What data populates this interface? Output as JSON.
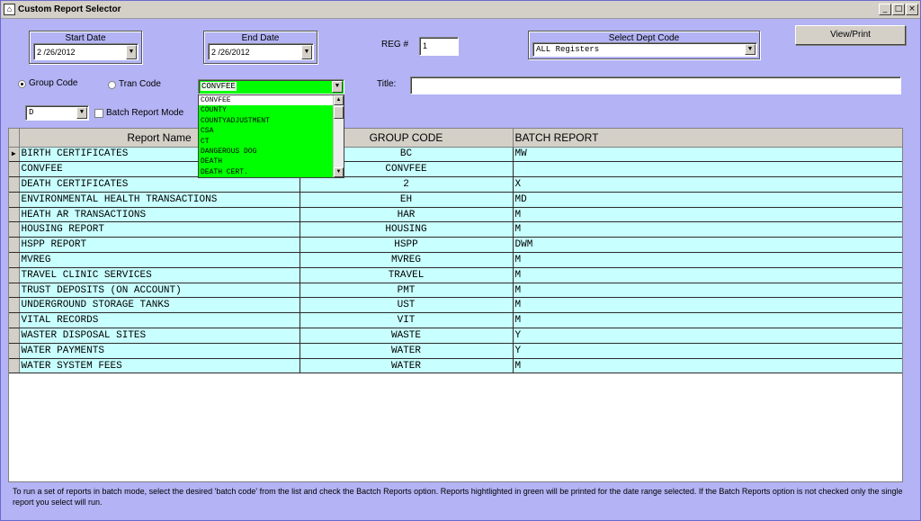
{
  "window": {
    "app_icon": "report-icon",
    "title": "Custom Report Selector",
    "min_glyph": "_",
    "max_glyph": "□",
    "close_glyph": "×"
  },
  "dates": {
    "start_label": "Start Date",
    "start_value": "2 /26/2012",
    "end_label": "End Date",
    "end_value": "2 /26/2012"
  },
  "reg": {
    "label": "REG #",
    "value": "1"
  },
  "dept": {
    "label": "Select Dept Code",
    "value": "ALL Registers"
  },
  "view_print_label": "View/Print",
  "mode": {
    "group_code_label": "Group Code",
    "tran_code_label": "Tran Code",
    "group_code_checked": true,
    "tran_code_checked": false
  },
  "group_combo": {
    "value": "CONVFEE",
    "highlight_color": "#00ff00",
    "options": [
      "CONVFEE",
      "COUNTY",
      "COUNTYADJUSTMENT",
      "CSA",
      "CT",
      "DANGEROUS DOG",
      "DEATH",
      "DEATH CERT."
    ]
  },
  "title_field": {
    "label": "Title:",
    "value": ""
  },
  "batch": {
    "code_value": "D",
    "checkbox_label": "Batch Report Mode",
    "checked": false
  },
  "grid": {
    "columns": [
      "Report Name",
      "GROUP CODE",
      "BATCH REPORT"
    ],
    "row_selector_glyph": "▶",
    "rows": [
      [
        "BIRTH CERTIFICATES",
        "BC",
        "MW"
      ],
      [
        "CONVFEE",
        "CONVFEE",
        ""
      ],
      [
        "DEATH CERTIFICATES",
        "2",
        "X"
      ],
      [
        "ENVIRONMENTAL HEALTH TRANSACTIONS",
        "EH",
        "MD"
      ],
      [
        "HEATH AR TRANSACTIONS",
        "HAR",
        "M"
      ],
      [
        "HOUSING REPORT",
        "HOUSING",
        "M"
      ],
      [
        "HSPP REPORT",
        "HSPP",
        "DWM"
      ],
      [
        "MVREG",
        "MVREG",
        "M"
      ],
      [
        "TRAVEL CLINIC SERVICES",
        "TRAVEL",
        "M"
      ],
      [
        "TRUST DEPOSITS (ON ACCOUNT)",
        "PMT",
        "M"
      ],
      [
        "UNDERGROUND STORAGE TANKS",
        "UST",
        "M"
      ],
      [
        "VITAL RECORDS",
        "VIT",
        "M"
      ],
      [
        "WASTER DISPOSAL SITES",
        "WASTE",
        "Y"
      ],
      [
        "WATER PAYMENTS",
        "WATER",
        "Y"
      ],
      [
        "WATER SYSTEM FEES",
        "WATER",
        "M"
      ]
    ]
  },
  "footer_note": "To run a set of reports in batch mode, select the desired 'batch code' from the list and check the Bactch Reports option. Reports hightlighted in green will be printed for the date range selected. If the Batch Reports option is not checked only the single report you select will run."
}
